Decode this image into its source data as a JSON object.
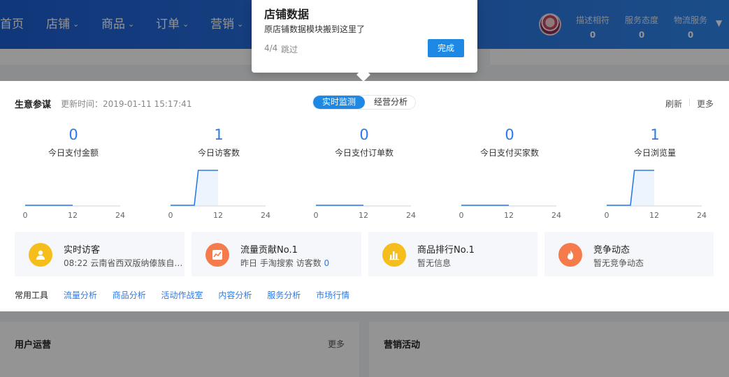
{
  "nav": {
    "items": [
      "首页",
      "店铺",
      "商品",
      "订单",
      "营销"
    ],
    "scores": [
      {
        "label": "描述相符",
        "value": "0"
      },
      {
        "label": "服务态度",
        "value": "0"
      },
      {
        "label": "物流服务",
        "value": "0"
      }
    ]
  },
  "business": {
    "title": "生意参谋",
    "update_time": "更新时间：2019-01-11 15:17:41",
    "tabs": {
      "realtime": "实时监测",
      "analysis": "经营分析"
    },
    "refresh": "刷新",
    "more": "更多",
    "metrics": [
      {
        "value": "0",
        "label": "今日支付金额"
      },
      {
        "value": "1",
        "label": "今日访客数"
      },
      {
        "value": "0",
        "label": "今日支付订单数"
      },
      {
        "value": "0",
        "label": "今日支付买家数"
      },
      {
        "value": "1",
        "label": "今日浏览量"
      }
    ],
    "axis": {
      "start": "0",
      "mid": "12",
      "end": "24"
    },
    "info": [
      {
        "title": "实时访客",
        "sub": "08:22 云南省西双版纳傣族自…",
        "color": "#f5be1c"
      },
      {
        "title": "流量贡献No.1",
        "sub_prefix": "昨日 手淘搜索 访客数",
        "sub_value": "0",
        "color": "#f57b4c"
      },
      {
        "title": "商品排行No.1",
        "sub": "暂无信息",
        "color": "#f5be1c"
      },
      {
        "title": "竞争动态",
        "sub": "暂无竞争动态",
        "color": "#f57b4c"
      }
    ],
    "tools_label": "常用工具",
    "tools": [
      "流量分析",
      "商品分析",
      "活动作战室",
      "内容分析",
      "服务分析",
      "市场行情"
    ]
  },
  "user_ops": {
    "title": "用户运营",
    "more": "更多"
  },
  "marketing": {
    "title": "营销活动"
  },
  "guide": {
    "title": "店铺数据",
    "desc": "原店铺数据模块搬到这里了",
    "step": "4/4",
    "skip": "跳过",
    "done": "完成"
  },
  "colors": {
    "accent": "#1e88e5",
    "nav_bg": "#2a74e0",
    "metric_blue": "#2c7be5"
  },
  "chart_data": [
    {
      "type": "line",
      "name": "今日支付金额",
      "x": [
        0,
        12
      ],
      "y": [
        0,
        0
      ],
      "xlim": [
        0,
        24
      ]
    },
    {
      "type": "line",
      "name": "今日访客数",
      "x": [
        0,
        6,
        7,
        12
      ],
      "y": [
        0,
        0,
        1,
        1
      ],
      "xlim": [
        0,
        24
      ]
    },
    {
      "type": "line",
      "name": "今日支付订单数",
      "x": [
        0,
        12
      ],
      "y": [
        0,
        0
      ],
      "xlim": [
        0,
        24
      ]
    },
    {
      "type": "line",
      "name": "今日支付买家数",
      "x": [
        0,
        12
      ],
      "y": [
        0,
        0
      ],
      "xlim": [
        0,
        24
      ]
    },
    {
      "type": "line",
      "name": "今日浏览量",
      "x": [
        0,
        6,
        7,
        12
      ],
      "y": [
        0,
        0,
        1,
        1
      ],
      "xlim": [
        0,
        24
      ]
    }
  ]
}
